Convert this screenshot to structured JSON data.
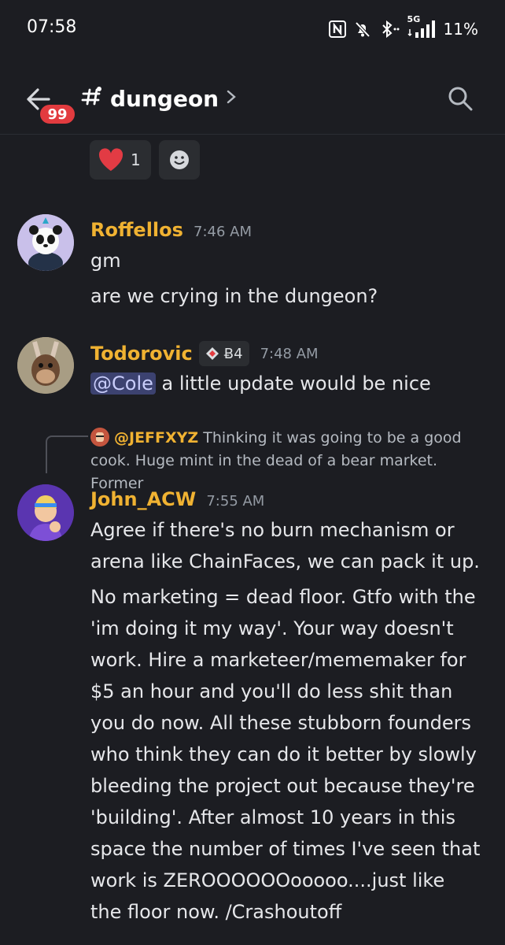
{
  "status_bar": {
    "time": "07:58",
    "network": "5G",
    "battery": "11%",
    "icons": [
      "nfc-icon",
      "bell-muted-icon",
      "bluetooth-icon",
      "signal-icon"
    ]
  },
  "header": {
    "unread_badge": "99",
    "channel_name": "dungeon",
    "icons": [
      "back-arrow-icon",
      "hash-icon",
      "chevron-right-icon",
      "search-icon"
    ]
  },
  "reactions": [
    {
      "emoji": "heart",
      "count": "1"
    },
    {
      "emoji": "add-reaction"
    }
  ],
  "messages": [
    {
      "author": "Roffellos",
      "time": "7:46 AM",
      "lines": [
        "gm",
        "are we crying in the dungeon?"
      ]
    },
    {
      "author": "Todorovic",
      "tag": "Ƀ4",
      "time": "7:48 AM",
      "mention": "@Cole",
      "text": "a little update would be nice"
    },
    {
      "reply": {
        "user": "@JEFFXYZ",
        "text": "Thinking it was going to be a good cook. Huge mint in the dead of a bear market. Former"
      },
      "author": "John_ACW",
      "time": "7:55 AM",
      "para1": [
        "Agree if there's no burn mechanism or",
        "arena like ChainFaces, we can pack it up."
      ],
      "para2": [
        "No marketing = dead floor. Gtfo with the",
        "'im doing it my way'. Your way doesn't",
        "work. Hire a marketeer/mememaker for",
        "$5 an hour and you'll do less shit than",
        "you do now. All these stubborn founders",
        "who think they can do it better by slowly",
        "bleeding the project out because they're",
        "'building'. After almost 10 years in this",
        "space the number of times I've seen that",
        "work is ZEROOOOOOooooo....just like",
        "the floor now. /Crashoutoff"
      ]
    }
  ],
  "colors": {
    "background": "#1c1d22",
    "username": "#f0b232",
    "badge": "#e23b3f",
    "mention_bg": "#3c4270"
  }
}
